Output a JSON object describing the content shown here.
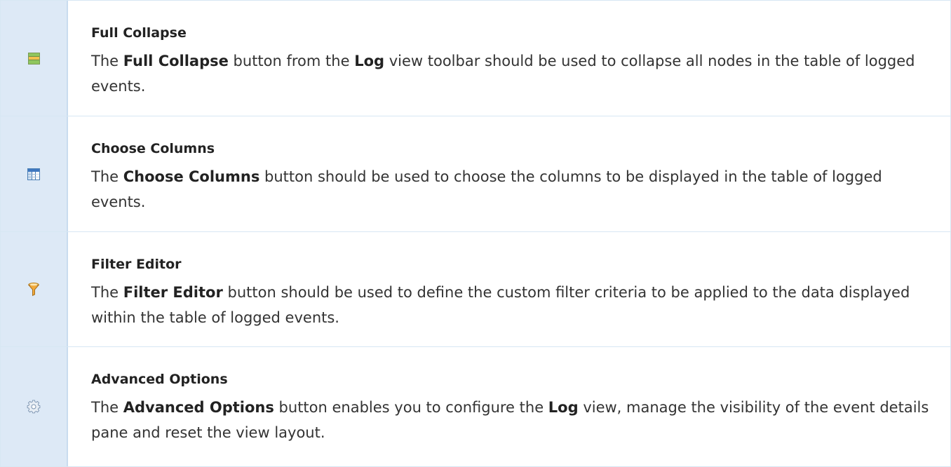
{
  "rows": [
    {
      "icon": "full-collapse-icon",
      "title": "Full Collapse",
      "desc": {
        "p1": "The ",
        "b1": "Full Collapse",
        "p2": " button from the ",
        "b2": "Log",
        "p3": " view toolbar should be used to collapse all nodes in the table of logged events."
      }
    },
    {
      "icon": "choose-columns-icon",
      "title": "Choose Columns",
      "desc": {
        "p1": "The ",
        "b1": "Choose Columns",
        "p2": " button should be used to choose the columns to be displayed in the table of logged events."
      }
    },
    {
      "icon": "filter-icon",
      "title": "Filter Editor",
      "desc": {
        "p1": "The ",
        "b1": "Filter Editor",
        "p2": " button should be used to define the custom filter criteria to be applied to the data displayed within the table of logged events."
      }
    },
    {
      "icon": "gear-icon",
      "title": "Advanced Options",
      "desc": {
        "p1": "The ",
        "b1": "Advanced Options",
        "p2": " button enables you to configure the ",
        "b2": "Log",
        "p3": " view, manage the visibility of the event details pane and reset the view layout."
      }
    }
  ],
  "colors": {
    "icon_cell_bg": "#dde9f6",
    "border": "#d7e7f3"
  }
}
